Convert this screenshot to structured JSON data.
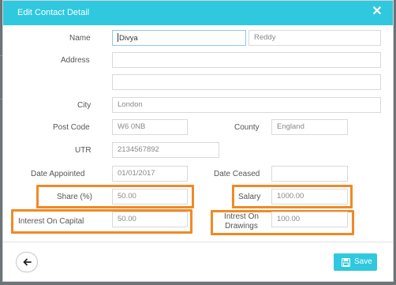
{
  "modal": {
    "title": "Edit Contact Detail",
    "close_icon": "close-icon"
  },
  "form": {
    "name_label": "Name",
    "first_name_value": "Divya",
    "last_name_placeholder": "Reddy",
    "address_label": "Address",
    "address_line1_value": "",
    "address_line2_value": "",
    "city_label": "City",
    "city_placeholder": "London",
    "postcode_label": "Post Code",
    "postcode_placeholder": "W6 0NB",
    "county_label": "County",
    "county_placeholder": "England",
    "utr_label": "UTR",
    "utr_placeholder": "2134567892",
    "date_appointed_label": "Date Appointed",
    "date_appointed_placeholder": "01/01/2017",
    "date_ceased_label": "Date Ceased",
    "date_ceased_value": "",
    "share_label": "Share (%)",
    "share_placeholder": "50.00",
    "salary_label": "Salary",
    "salary_placeholder": "1000.00",
    "interest_capital_label": "Interest On Capital",
    "interest_capital_placeholder": "50.00",
    "interest_drawings_label_line1": "Intrest On",
    "interest_drawings_label_line2": "Drawings",
    "interest_drawings_placeholder": "100.00"
  },
  "footer": {
    "back_icon": "arrow-left-icon",
    "save_label": "Save",
    "save_icon": "floppy-disk-icon"
  },
  "colors": {
    "header": "#2fc8df",
    "highlight": "#f08a24",
    "save_button": "#2fc8df"
  }
}
